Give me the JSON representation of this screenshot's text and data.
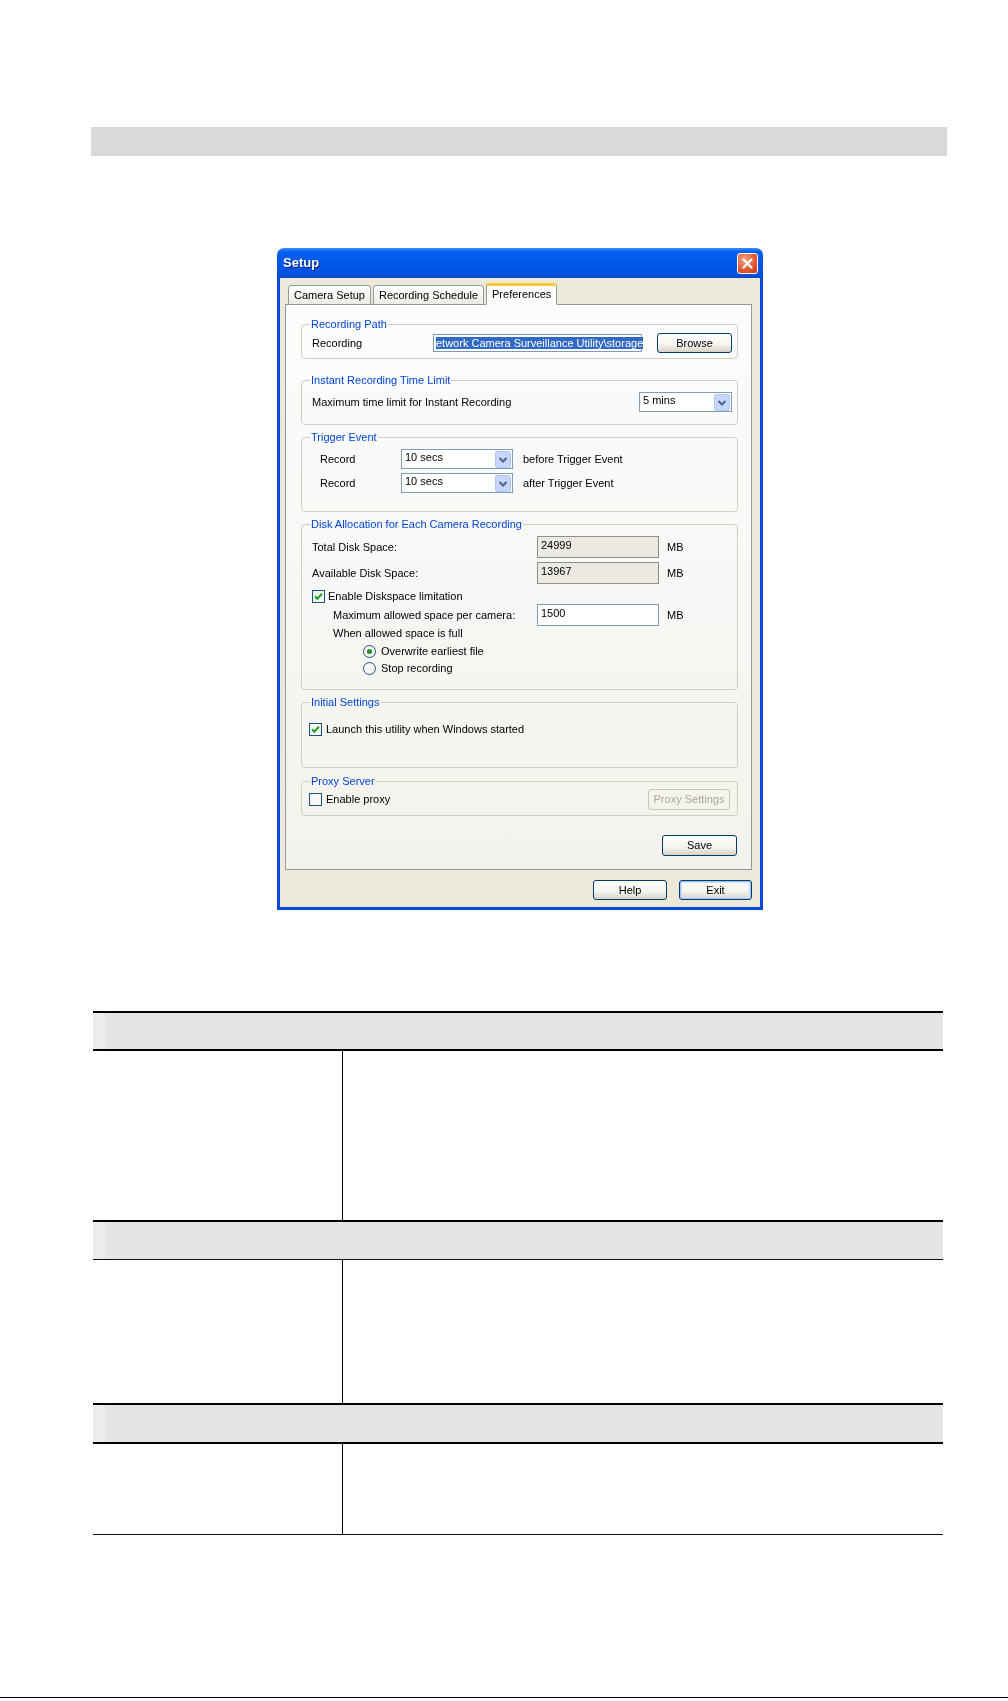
{
  "window": {
    "title": "Setup"
  },
  "tabs": [
    {
      "label": "Camera Setup",
      "selected": false
    },
    {
      "label": "Recording Schedule",
      "selected": false
    },
    {
      "label": "Preferences",
      "selected": true
    }
  ],
  "recording_path": {
    "legend": "Recording Path",
    "label": "Recording",
    "value": "etwork Camera Surveillance Utility\\storage",
    "value_highlighted": true,
    "button": "Browse"
  },
  "instant_recording": {
    "legend": "Instant Recording Time Limit",
    "label": "Maximum time limit for Instant Recording",
    "value": "5 mins"
  },
  "trigger_event": {
    "legend": "Trigger Event",
    "rows": [
      {
        "label": "Record",
        "value": "10 secs",
        "note": "before Trigger Event"
      },
      {
        "label": "Record",
        "value": "10 secs",
        "note": "after Trigger Event"
      }
    ]
  },
  "disk_allocation": {
    "legend": "Disk Allocation for Each Camera Recording",
    "fields": [
      {
        "label": "Total Disk Space:",
        "value": "24999",
        "unit": "MB",
        "readonly": true
      },
      {
        "label": "Available Disk Space:",
        "value": "13967",
        "unit": "MB",
        "readonly": true
      }
    ],
    "limit": {
      "label": "Enable Diskspace limitation",
      "checked": true
    },
    "max_space": {
      "label": "Maximum allowed space per camera:",
      "value": "1500",
      "unit": "MB",
      "readonly": false
    },
    "when_full": {
      "label": "When allowed space is full",
      "options": [
        {
          "label": "Overwrite earliest file",
          "selected": true
        },
        {
          "label": "Stop recording",
          "selected": false
        }
      ]
    }
  },
  "initial_settings": {
    "legend": "Initial Settings",
    "launch_on_start": {
      "label": "Launch this utility when Windows started",
      "checked": true
    }
  },
  "proxy_server": {
    "legend": "Proxy Server",
    "enable": {
      "label": "Enable proxy",
      "checked": false
    },
    "button": {
      "label": "Proxy Settings",
      "disabled": true
    }
  },
  "save_button": {
    "label": "Save"
  },
  "dialog_buttons": [
    {
      "label": "Help",
      "default": false
    },
    {
      "label": "Exit",
      "default": true
    }
  ]
}
